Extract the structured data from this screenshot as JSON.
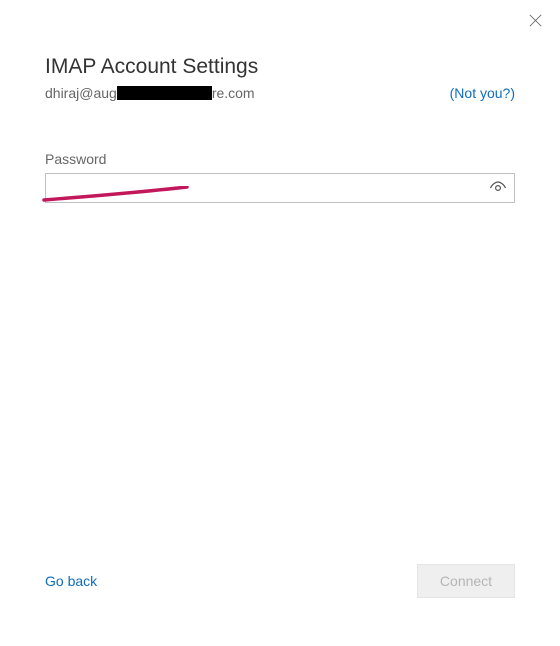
{
  "header": {
    "title": "IMAP Account Settings",
    "email_prefix": "dhiraj@aug",
    "email_suffix": "re.com",
    "not_you_label": "(Not you?)"
  },
  "form": {
    "password_label": "Password",
    "password_value": ""
  },
  "footer": {
    "go_back_label": "Go back",
    "connect_label": "Connect"
  },
  "colors": {
    "link": "#0f6cbd",
    "annotation": "#c2185b",
    "border": "#c0c0c0"
  }
}
